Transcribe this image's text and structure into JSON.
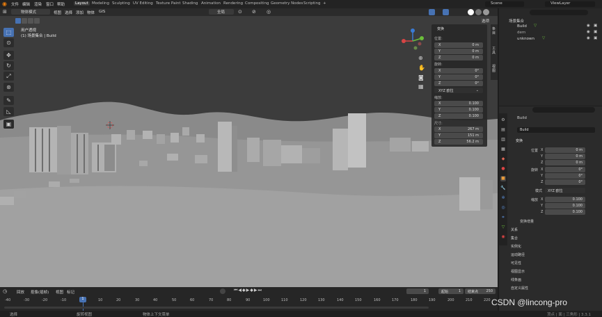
{
  "topbar": {
    "menus": [
      "文件",
      "编辑",
      "渲染",
      "窗口",
      "帮助"
    ],
    "workspaces": [
      "Layout",
      "Modeling",
      "Sculpting",
      "UV Editing",
      "Texture Paint",
      "Shading",
      "Animation",
      "Rendering",
      "Compositing",
      "Geometry Nodes",
      "Scripting"
    ],
    "active_workspace": "Layout",
    "scene": "Scene",
    "view_layer": "ViewLayer"
  },
  "header3d": {
    "mode": "物体模式",
    "menus": [
      "视图",
      "选择",
      "添加",
      "物体",
      "GIS"
    ],
    "orientation": "全局",
    "options": "选项"
  },
  "viewport": {
    "view_name": "用户透视",
    "collection_info": "(1) 场景集合 | Build"
  },
  "npanel": {
    "title": "变换",
    "location_label": "位置:",
    "location": [
      {
        "k": "X",
        "v": "0 m"
      },
      {
        "k": "Y",
        "v": "0 m"
      },
      {
        "k": "Z",
        "v": "0 m"
      }
    ],
    "rotation_label": "旋转:",
    "rotation": [
      {
        "k": "X",
        "v": "0°"
      },
      {
        "k": "Y",
        "v": "0°"
      },
      {
        "k": "Z",
        "v": "0°"
      }
    ],
    "rotation_mode": "XYZ 欧拉",
    "scale_label": "缩放:",
    "scale": [
      {
        "k": "X",
        "v": "0.100"
      },
      {
        "k": "Y",
        "v": "0.100"
      },
      {
        "k": "Z",
        "v": "0.100"
      }
    ],
    "dimensions_label": "尺寸:",
    "dimensions": [
      {
        "k": "X",
        "v": "267 m"
      },
      {
        "k": "Y",
        "v": "151 m"
      },
      {
        "k": "Z",
        "v": "56.2 m"
      }
    ],
    "side_tabs": [
      "条目",
      "工具",
      "视图"
    ]
  },
  "outliner": {
    "root": "场景集合",
    "items": [
      "Build",
      "dem",
      "unknown"
    ]
  },
  "properties": {
    "object_name": "Build",
    "data_name": "Build",
    "transform_title": "变换",
    "location_label": "位置",
    "location": [
      "0 m",
      "0 m",
      "0 m"
    ],
    "rotation_label": "旋转",
    "rotation": [
      "0°",
      "0°",
      "0°"
    ],
    "mode_label": "模式",
    "mode_value": "XYZ 欧拉",
    "scale_label": "缩放",
    "scale": [
      "0.100",
      "0.100",
      "0.100"
    ],
    "axes": [
      "X",
      "Y",
      "Z"
    ],
    "delta": "变换增量",
    "sections": [
      "关系",
      "集合",
      "实例化",
      "运动路径",
      "可见性",
      "视图显示",
      "线条画",
      "自定义属性"
    ]
  },
  "timeline": {
    "menus": [
      "回放",
      "抠像(插帧)",
      "视图",
      "标记"
    ],
    "current_frame": "1",
    "start_label": "起始",
    "start_value": "1",
    "end_label": "结束点",
    "end_value": "250",
    "ticks": [
      "-40",
      "-30",
      "-20",
      "-10",
      "1",
      "10",
      "20",
      "30",
      "40",
      "50",
      "60",
      "70",
      "80",
      "90",
      "100",
      "110",
      "120",
      "130",
      "140",
      "150",
      "160",
      "170",
      "180",
      "190",
      "200",
      "210",
      "220"
    ]
  },
  "status": {
    "select": "选择",
    "rotate": "旋转视图",
    "context": "物体上下文菜单",
    "version": "顶点 | 面 | 三角形 | 3.3.1"
  },
  "watermark": "CSDN @lincong-pro",
  "colors": {
    "accent": "#4772b3",
    "bg": "#3b3b3b",
    "panel": "#2b2b2b"
  }
}
